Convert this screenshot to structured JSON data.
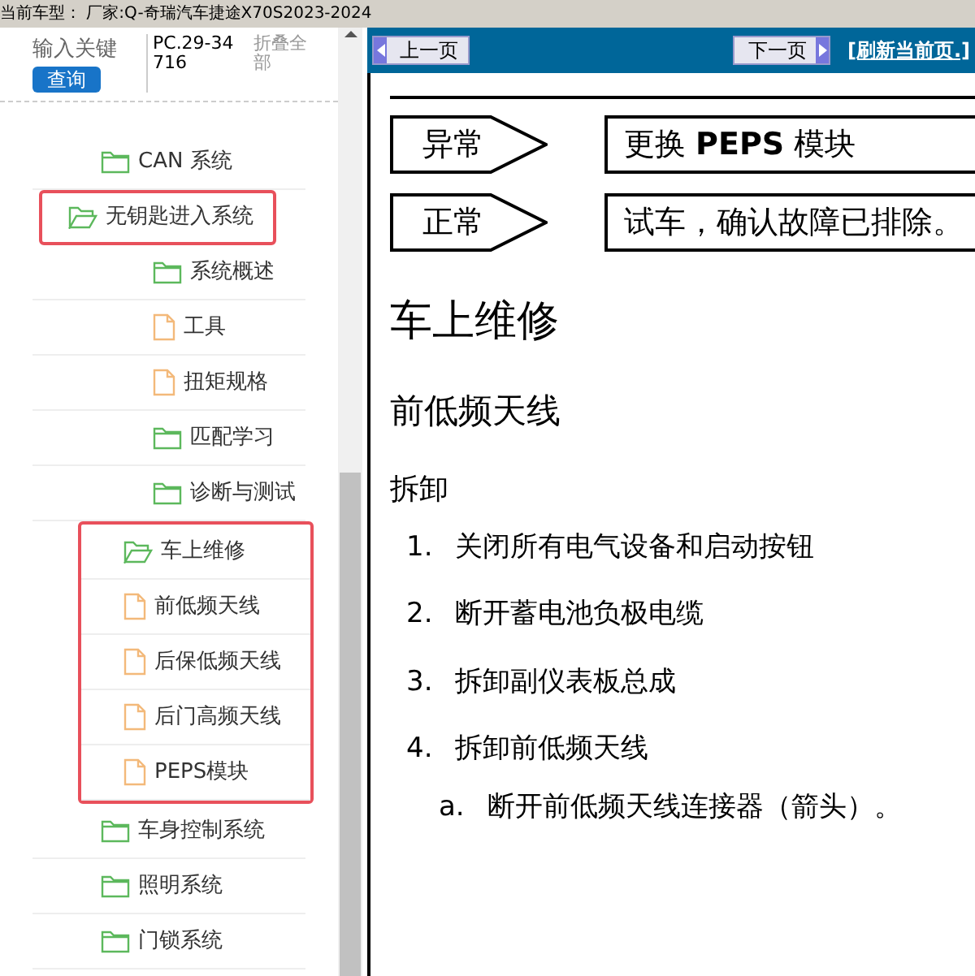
{
  "top_bar": {
    "vehicle": "当前车型： 厂家:Q-奇瑞汽车捷途X70S2023-2024"
  },
  "search": {
    "placeholder": "输入关键",
    "button": "查询",
    "code": "PC.29-34716",
    "collapse": "折叠全部"
  },
  "tree": [
    {
      "label": "CAN 系统",
      "kind": "folder",
      "expanded": false
    },
    {
      "label": "无钥匙进入系统",
      "kind": "folder",
      "expanded": true,
      "highlighted_row": true,
      "children": [
        {
          "label": "系统概述",
          "kind": "folder",
          "expanded": false
        },
        {
          "label": "工具",
          "kind": "file"
        },
        {
          "label": "扭矩规格",
          "kind": "file"
        },
        {
          "label": "匹配学习",
          "kind": "folder",
          "expanded": false
        },
        {
          "label": "诊断与测试",
          "kind": "folder",
          "expanded": false
        },
        {
          "label": "车上维修",
          "kind": "folder",
          "expanded": true,
          "highlighted_group": true,
          "children": [
            {
              "label": "前低频天线",
              "kind": "file"
            },
            {
              "label": "后保低频天线",
              "kind": "file"
            },
            {
              "label": "后门高频天线",
              "kind": "file"
            },
            {
              "label": "PEPS模块",
              "kind": "file"
            }
          ]
        }
      ]
    },
    {
      "label": "车身控制系统",
      "kind": "folder",
      "expanded": false
    },
    {
      "label": "照明系统",
      "kind": "folder",
      "expanded": false
    },
    {
      "label": "门锁系统",
      "kind": "folder",
      "expanded": false
    }
  ],
  "nav": {
    "prev": "上一页",
    "next": "下一页",
    "refresh": "[刷新当前页.]"
  },
  "flow": [
    {
      "status": "异常",
      "action": "更换 **PEPS** 模块"
    },
    {
      "status": "正常",
      "action": "试车，确认故障已排除。"
    }
  ],
  "heading": "车上维修",
  "subheading": "前低频天线",
  "section": "拆卸",
  "steps": [
    {
      "number": "1.",
      "text": "关闭所有电气设备和启动按钮"
    },
    {
      "number": "2.",
      "text": "断开蓄电池负极电缆"
    },
    {
      "number": "3.",
      "text": "拆卸副仪表板总成"
    },
    {
      "number": "4.",
      "text": "拆卸前低频天线",
      "children": [
        {
          "number": "a.",
          "text": "断开前低频天线连接器（箭头）。"
        }
      ]
    }
  ]
}
